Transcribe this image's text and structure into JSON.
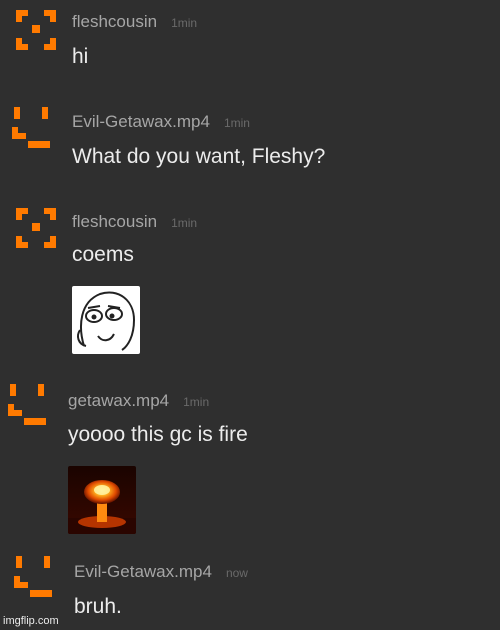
{
  "accent_color": "#ff7a00",
  "messages": [
    {
      "username": "fleshcousin",
      "time": "1min",
      "text": "hi",
      "avatar": "square-face-icon"
    },
    {
      "username": "Evil-Getawax.mp4",
      "time": "1min",
      "text": "What do you want, Fleshy?",
      "avatar": "smile-face-icon"
    },
    {
      "username": "fleshcousin",
      "time": "1min",
      "text": "coems",
      "avatar": "square-face-icon",
      "attachment": "meme-face-image"
    },
    {
      "username": "getawax.mp4",
      "time": "1min",
      "text": "yoooo this gc is fire",
      "avatar": "smile-face-icon",
      "attachment": "explosion-image"
    },
    {
      "username": "Evil-Getawax.mp4",
      "time": "now",
      "text": "bruh.",
      "avatar": "smile-face-icon"
    }
  ],
  "watermark": "imgflip.com"
}
